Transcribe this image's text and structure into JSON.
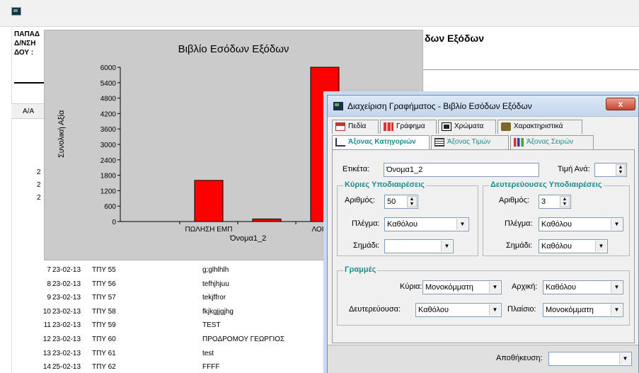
{
  "report": {
    "header_lines": [
      "ΠΑΠΑΔ",
      "Δ/ΝΣΗ",
      "ΔΟΥ :"
    ],
    "title_visible": "δων Εξόδων",
    "col_hdr": "Α/Α",
    "left_numbers": [
      "2",
      "2",
      "2"
    ],
    "rows": [
      {
        "aa": "7",
        "date": "23-02-13",
        "ref": "ΤΠΥ 55",
        "desc": "g;glhlhlh"
      },
      {
        "aa": "8",
        "date": "23-02-13",
        "ref": "ΤΠΥ 56",
        "desc": "tefhjhjuu"
      },
      {
        "aa": "9",
        "date": "23-02-13",
        "ref": "ΤΠΥ 57",
        "desc": "tekjffror"
      },
      {
        "aa": "10",
        "date": "23-02-13",
        "ref": "ΤΠΥ 58",
        "desc": "fkjkgjjgjhg"
      },
      {
        "aa": "11",
        "date": "23-02-13",
        "ref": "ΤΠΥ 59",
        "desc": "TEST"
      },
      {
        "aa": "12",
        "date": "23-02-13",
        "ref": "ΤΠΥ 60",
        "desc": "ΠΡΟΔΡΟΜΟΥ ΓΕΩΡΓΙΟΣ"
      },
      {
        "aa": "13",
        "date": "23-02-13",
        "ref": "ΤΠΥ 61",
        "desc": "test"
      },
      {
        "aa": "14",
        "date": "25-02-13",
        "ref": "ΤΠΥ 62",
        "desc": "FFFF"
      }
    ]
  },
  "chart": {
    "title": "Βιβλίο Εσόδων Εξόδων",
    "ylabel": "Συνολική Αξία",
    "xlabel": "Όνομα1_2",
    "bar_color": "#ff0000"
  },
  "chart_data": {
    "type": "bar",
    "title": "Βιβλίο Εσόδων Εξόδων",
    "ylabel": "Συνολική Αξία",
    "xlabel": "Όνομα1_2",
    "ylim": [
      0,
      6000
    ],
    "yticks": [
      "0",
      "600",
      "1200",
      "1800",
      "2400",
      "3000",
      "3600",
      "4200",
      "4800",
      "5400",
      "6000"
    ],
    "categories": [
      "",
      "ΠΩΛΗΣΗ ΕΜΠ",
      "",
      "ΛΟΙΠΕΣ"
    ],
    "values": [
      0,
      1600,
      100,
      6000
    ]
  },
  "dialog": {
    "title": "Διαχείριση Γραφήματος - Βιβλίο Εσόδων Εξόδων",
    "close": "x",
    "tabs_row1": [
      "Πεδία",
      "Γράφημα",
      "Χρώματα",
      "Χαρακτηριστικά"
    ],
    "tabs_row2": [
      "Άξονας Κατηγοριών",
      "Άξονας Τιμών",
      "Άξονας Σειρών"
    ],
    "label_lbl": "Ετικέτα:",
    "label_val": "Όνομα1_2",
    "value_per_lbl": "Τιμή Ανά:",
    "value_per_val": "",
    "major": {
      "title": "Κύριες Υποδιαιρέσεις",
      "count_lbl": "Αριθμός:",
      "count_val": "50",
      "grid_lbl": "Πλέγμα:",
      "grid_val": "Καθόλου",
      "mark_lbl": "Σημάδι:",
      "mark_val": ""
    },
    "minor": {
      "title": "Δευτερεύουσες Υποδιαιρέσεις",
      "count_lbl": "Αριθμός:",
      "count_val": "3",
      "grid_lbl": "Πλέγμα:",
      "grid_val": "Καθόλου",
      "mark_lbl": "Σημάδι:",
      "mark_val": "Καθόλου"
    },
    "lines": {
      "title": "Γραμμές",
      "main_lbl": "Κύρια:",
      "main_val": "Μονοκόμματη",
      "initial_lbl": "Αρχική:",
      "initial_val": "Καθόλου",
      "secondary_lbl": "Δευτερεύουσα:",
      "secondary_val": "Καθόλου",
      "frame_lbl": "Πλαίσιο:",
      "frame_val": "Μονοκόμματη"
    },
    "save_lbl": "Αποθήκευση:",
    "save_val": ""
  }
}
